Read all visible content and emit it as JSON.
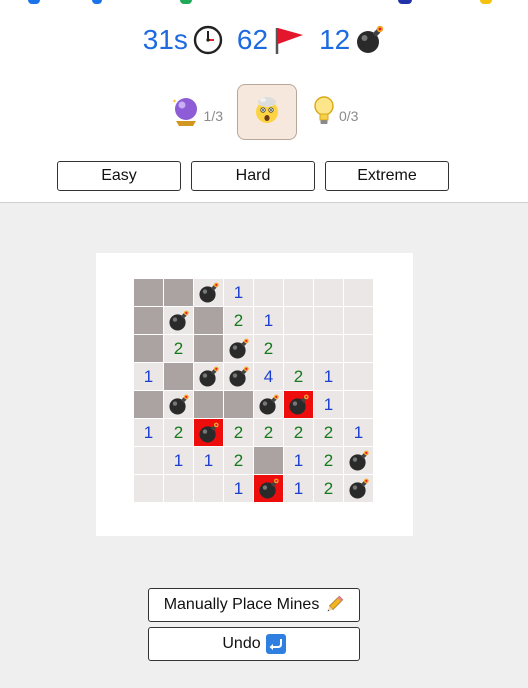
{
  "stats": {
    "time": "31s",
    "flags": "62",
    "bombs": "12"
  },
  "helpers": {
    "crystal_ball_count": "1/3",
    "hint_count": "0/3"
  },
  "levels": [
    "Easy",
    "Hard",
    "Extreme"
  ],
  "board": {
    "rows": [
      [
        "c",
        "c",
        "m",
        "1",
        "e",
        "e",
        "e",
        "e"
      ],
      [
        "c",
        "m",
        "c",
        "2",
        "1",
        "e",
        "e",
        "e"
      ],
      [
        "c",
        "2",
        "c",
        "m",
        "2",
        "e",
        "e",
        "e"
      ],
      [
        "1",
        "c",
        "m",
        "m",
        "4",
        "2",
        "1",
        "e"
      ],
      [
        "c",
        "m",
        "c",
        "c",
        "m",
        "X",
        "1",
        "e"
      ],
      [
        "1",
        "2",
        "X",
        "2",
        "2",
        "2",
        "2",
        "1"
      ],
      [
        "e",
        "1",
        "1",
        "2",
        "c",
        "1",
        "2",
        "m"
      ],
      [
        "e",
        "e",
        "e",
        "1",
        "X",
        "1",
        "2",
        "m"
      ]
    ]
  },
  "actions": {
    "manual_label": "Manually Place Mines",
    "undo_label": "Undo"
  },
  "colors": {
    "accent": "#1e6be0",
    "exploded": "#ee0d0d",
    "covered": "#aba3a1",
    "revealed": "#ebe7e6"
  }
}
